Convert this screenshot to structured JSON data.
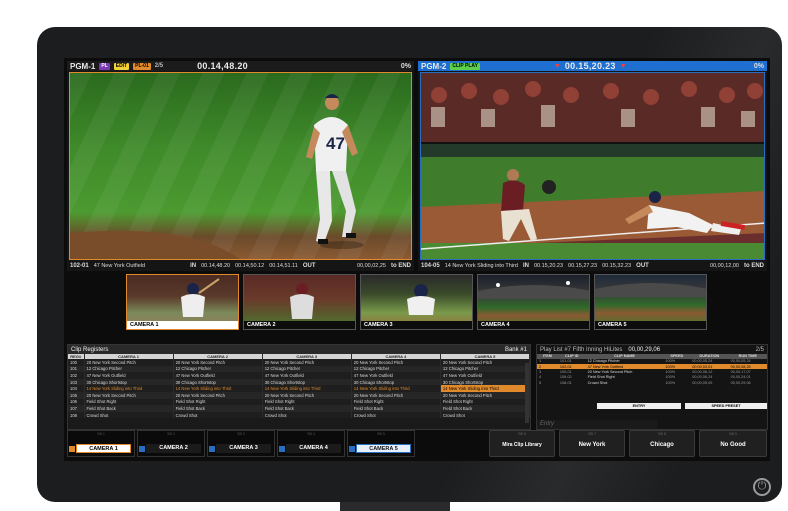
{
  "pgm1": {
    "label": "PGM-1",
    "tags": [
      "PL",
      "EDIT",
      "PL-01"
    ],
    "page": "2/5",
    "timecode": "00.14,48.20",
    "percent": "0%",
    "clip_id": "102-01",
    "clip_name": "47 New York Outfield",
    "in_label": "IN",
    "in_tc": "00.14,48.20",
    "mid_tc1": "00.14,50.12",
    "mid_tc2": "00.14,51.11",
    "out_label": "OUT",
    "remain": "00,00,02,25",
    "end_label": "to END"
  },
  "pgm2": {
    "label": "PGM-2",
    "tag": "CLIP PLAY",
    "timecode": "00.15,20.23",
    "percent": "0%",
    "clip_id": "104-05",
    "clip_name": "14 New York Sliding into Third",
    "in_label": "IN",
    "in_tc": "00.15,20.23",
    "mid_tc1": "00.15,27.23",
    "mid_tc2": "00.15,32.23",
    "out_label": "OUT",
    "remain": "00,00,12,00",
    "end_label": "to END"
  },
  "thumbs": [
    "CAMERA 1",
    "CAMERA 2",
    "CAMERA 3",
    "CAMERA 4",
    "CAMERA 5"
  ],
  "clip_registers": {
    "title": "Clip Registers",
    "bank": "Bank #1",
    "headers": [
      "REG#",
      "CAMERA 1",
      "CAMERA 2",
      "CAMERA 3",
      "CAMERA 4",
      "CAMERA 5"
    ],
    "rows": [
      [
        "100",
        "20 New York Second Pitch",
        "20 New York Second Pitch",
        "20 New York Second Pitch",
        "20 New York Second Pitch",
        "20 New York Second Pitch"
      ],
      [
        "101",
        "12 Chicago Pitcher",
        "12 Chicago Pitcher",
        "12 Chicago Pitcher",
        "12 Chicago Pitcher",
        "12 Chicago Pitcher"
      ],
      [
        "102",
        "47 New York Outfield",
        "47 New York Outfield",
        "47 New York Outfield",
        "47 New York Outfield",
        "47 New York Outfield"
      ],
      [
        "103",
        "30 Chicago Shortstop",
        "30 Chicago Shortstop",
        "30 Chicago Shortstop",
        "30 Chicago Shortstop",
        "30 Chicago Shortstop"
      ],
      [
        "104",
        "14 New York Sliding into Third",
        "14 New York Sliding into Third",
        "14 New York Sliding into Third",
        "14 New York Sliding into Third",
        "14 New York Sliding into Third"
      ],
      [
        "105",
        "20 New York Second Pitch",
        "20 New York Second Pitch",
        "20 New York Second Pitch",
        "20 New York Second Pitch",
        "20 New York Second Pitch"
      ],
      [
        "106",
        "Field Shot Right",
        "Field Shot Right",
        "Field Shot Right",
        "Field Shot Right",
        "Field Shot Right"
      ],
      [
        "107",
        "Field Shot Back",
        "Field Shot Back",
        "Field Shot Back",
        "Field Shot Back",
        "Field Shot Back"
      ],
      [
        "108",
        "Crowd Shot",
        "Crowd Shot",
        "Crowd Shot",
        "Crowd Shot",
        "Crowd Shot"
      ]
    ]
  },
  "playlist": {
    "title": "Play List #7 Fifth Inning HiLites",
    "timecode": "00,00,29,06",
    "page": "2/5",
    "headers": [
      "ITEM",
      "CLIP ID",
      "CLIP NAME",
      "SPEED",
      "DURATION",
      "RUN TIME"
    ],
    "rows": [
      [
        "1",
        "101-01",
        "12 Chicago Pitcher",
        "100%",
        "00,00,05,24",
        "00,00,05,24"
      ],
      [
        "2",
        "102-01",
        "47 New York Outfield",
        "100%",
        "00,00,03,01",
        "00,00,08,25"
      ],
      [
        "3",
        "100-01",
        "20 New York Second Pitch",
        "100%",
        "00,00,08,12",
        "00,00,17,07"
      ],
      [
        "4",
        "106-02",
        "Field Shot Right",
        "100%",
        "00,00,06,24",
        "00,00,24,01"
      ],
      [
        "5",
        "108-01",
        "Crowd Shot",
        "100%",
        "00,00,05,05",
        "00,00,29,06"
      ]
    ],
    "entry_placeholder": "Entry",
    "entry_btn": "ENTRY",
    "speed_btn": "SPEED PRESET"
  },
  "bottom": {
    "cameras": [
      "CAMERA 1",
      "CAMERA 2",
      "CAMERA 3",
      "CAMERA 4",
      "CAMERA 5"
    ],
    "cam_sub": [
      "SB 1",
      "SB 2",
      "SB 3",
      "SB 4",
      "SB 5"
    ],
    "actions": [
      "Mira Clip Library",
      "New York",
      "Chicago",
      "No Good"
    ],
    "action_sub": [
      "SB 6",
      "SB 7",
      "SB 8",
      "SB 9",
      "SB 10"
    ]
  },
  "colors": {
    "accent": "#e08a2c",
    "select_blue": "#2a6fbf"
  }
}
